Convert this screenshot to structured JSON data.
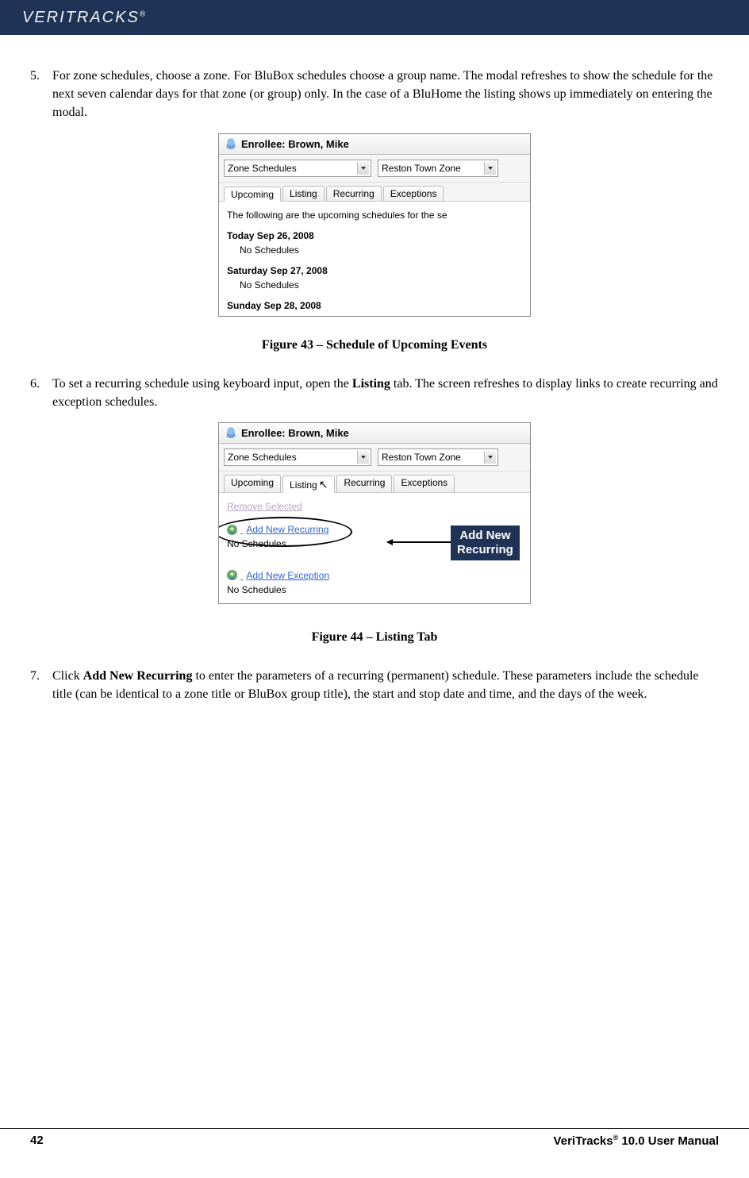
{
  "header": {
    "brand": "VERITRACKS",
    "reg": "®"
  },
  "steps": {
    "5": {
      "num": "5.",
      "text_a": "For zone schedules, choose a zone. For BluBox schedules choose a group name.  The modal refreshes to show the schedule for the next seven calendar days for that zone (or group) only.  In the case of a BluHome the listing shows up immediately on entering the modal."
    },
    "6": {
      "num": "6.",
      "text_a": "To set a recurring schedule using keyboard input, open the ",
      "bold": "Listing",
      "text_b": " tab. The screen refreshes to display links to create recurring and exception schedules."
    },
    "7": {
      "num": "7.",
      "text_a": "Click ",
      "bold": "Add New Recurring",
      "text_b": " to enter the parameters of a recurring (permanent) schedule.  These parameters include the schedule title (can be identical to a zone title or BluBox group title), the start and stop date and time, and the days of the week."
    }
  },
  "figure43": {
    "enrollee_label": "Enrollee: Brown, Mike",
    "select1": "Zone Schedules",
    "select2": "Reston Town Zone",
    "tabs": [
      "Upcoming",
      "Listing",
      "Recurring",
      "Exceptions"
    ],
    "intro": "The following are the upcoming schedules for the se",
    "day1_head": "Today Sep 26, 2008",
    "day1_sub": "No Schedules",
    "day2_head": "Saturday Sep 27, 2008",
    "day2_sub": "No Schedules",
    "day3_head": "Sunday Sep 28, 2008",
    "caption": "Figure 43 – Schedule of Upcoming Events"
  },
  "figure44": {
    "enrollee_label": "Enrollee: Brown, Mike",
    "select1": "Zone Schedules",
    "select2": "Reston Town Zone",
    "tabs": [
      "Upcoming",
      "Listing",
      "Recurring",
      "Exceptions"
    ],
    "remove": "Remove Selected",
    "add_recurring": "Add New Recurring",
    "no_sched1": "No Schedules",
    "add_exception": "Add New Exception",
    "no_sched2": "No Schedules",
    "callout_line1": "Add New",
    "callout_line2": "Recurring",
    "caption": "Figure 44 – Listing Tab"
  },
  "footer": {
    "page": "42",
    "product_a": "VeriTracks",
    "product_sup": "®",
    "product_b": " 10.0 User Manual"
  }
}
